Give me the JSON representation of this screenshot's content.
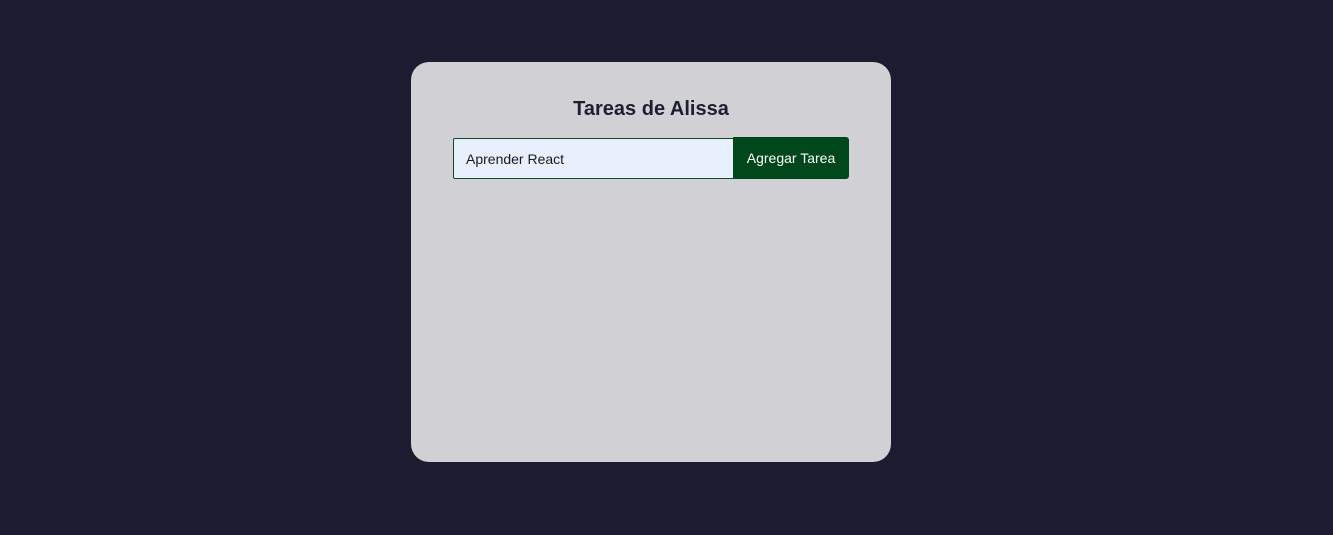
{
  "app": {
    "title": "Tareas de Alissa"
  },
  "form": {
    "input_value": "Aprender React",
    "button_label": "Agregar Tarea"
  },
  "colors": {
    "background": "#1c1c31",
    "card": "#d1d0d4",
    "button": "#00471c",
    "input": "#e8f0fd"
  }
}
